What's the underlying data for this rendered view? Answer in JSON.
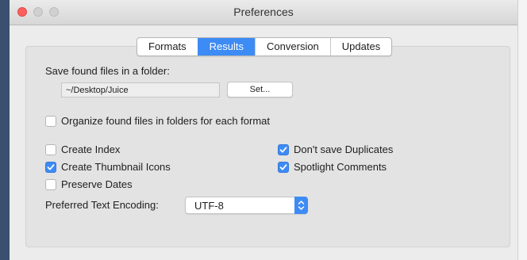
{
  "window": {
    "title": "Preferences"
  },
  "tabs": [
    {
      "label": "Formats",
      "active": false
    },
    {
      "label": "Results",
      "active": true
    },
    {
      "label": "Conversion",
      "active": false
    },
    {
      "label": "Updates",
      "active": false
    }
  ],
  "save_folder": {
    "label": "Save found files in a folder:",
    "path_value": "~/Desktop/Juice",
    "set_button": "Set..."
  },
  "options": {
    "organize": {
      "label": "Organize found files in folders for each format",
      "checked": false
    },
    "create_index": {
      "label": "Create Index",
      "checked": false
    },
    "create_thumbnail_icons": {
      "label": "Create Thumbnail Icons",
      "checked": true
    },
    "preserve_dates": {
      "label": "Preserve Dates",
      "checked": false
    },
    "dont_save_duplicates": {
      "label": "Don't save Duplicates",
      "checked": true
    },
    "spotlight_comments": {
      "label": "Spotlight Comments",
      "checked": true
    }
  },
  "encoding": {
    "label": "Preferred Text Encoding:",
    "selected": "UTF-8"
  },
  "colors": {
    "accent": "#3d8bf5",
    "close_button": "#fc605c"
  },
  "icons": [
    "close-traffic-light",
    "minimize-traffic-light",
    "zoom-traffic-light",
    "checkmark-icon",
    "popup-arrows-icon"
  ]
}
